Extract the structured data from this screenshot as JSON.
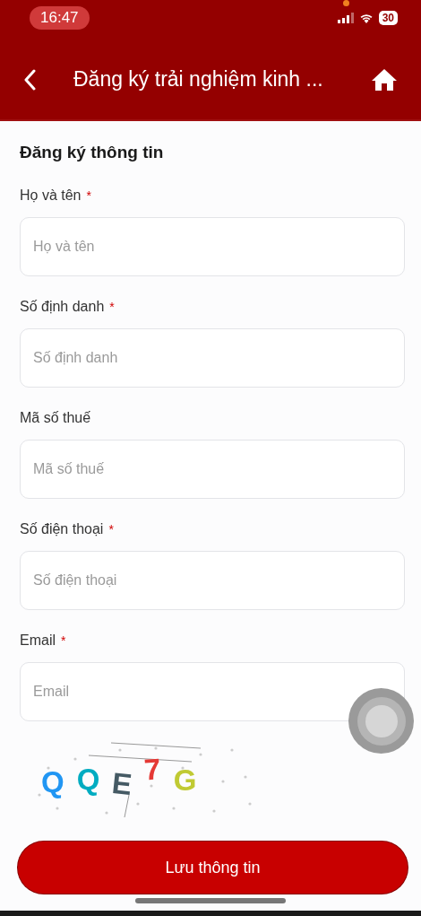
{
  "status_bar": {
    "time": "16:47",
    "battery": "30",
    "privacy_dot": true
  },
  "header": {
    "title": "Đăng ký trải nghiệm kinh ..."
  },
  "form": {
    "title": "Đăng ký thông tin",
    "fields": [
      {
        "label": "Họ và tên",
        "required_mark": "*",
        "placeholder": "Họ và tên"
      },
      {
        "label": "Số định danh",
        "required_mark": "*",
        "placeholder": "Số định danh"
      },
      {
        "label": "Mã số thuế",
        "placeholder": "Mã số thuế"
      },
      {
        "label": "Số điện thoại",
        "required_mark": "*",
        "placeholder": "Số điện thoại"
      },
      {
        "label": "Email",
        "required_mark": "*",
        "placeholder": "Email"
      }
    ],
    "captcha": [
      {
        "text": "Q",
        "color": "#2196f3"
      },
      {
        "text": "Q",
        "color": "#00acc1"
      },
      {
        "text": "E",
        "color": "#455a64"
      },
      {
        "text": "7",
        "color": "#e53935"
      },
      {
        "text": "G",
        "color": "#c0ca33"
      }
    ],
    "submit": "Lưu thông tin"
  },
  "assistive_touch": true
}
